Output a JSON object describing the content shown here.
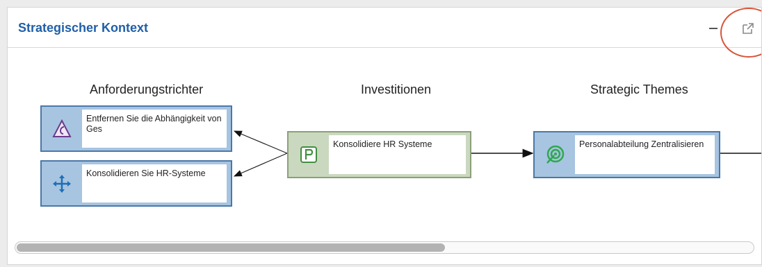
{
  "header": {
    "title": "Strategischer Kontext"
  },
  "columns": [
    {
      "title": "Anforderungstrichter"
    },
    {
      "title": "Investitionen"
    },
    {
      "title": "Strategic Themes"
    }
  ],
  "nodes": {
    "requirement_1": {
      "label": "Entfernen Sie die Abhängigkeit von Ges",
      "icon": "request-funnel-icon"
    },
    "requirement_2": {
      "label": "Konsolidieren Sie HR-Systeme",
      "icon": "move-arrows-icon"
    },
    "investment_1": {
      "label": "Konsolidiere HR Systeme",
      "icon": "project-p-icon"
    },
    "theme_1": {
      "label": "Personalabteilung Zentralisieren",
      "icon": "strategic-theme-icon"
    }
  },
  "colors": {
    "title": "#1f5fa8",
    "blue_node": "#a7c4e0",
    "green_node": "#cbd8c0",
    "highlight": "#d9533a"
  }
}
